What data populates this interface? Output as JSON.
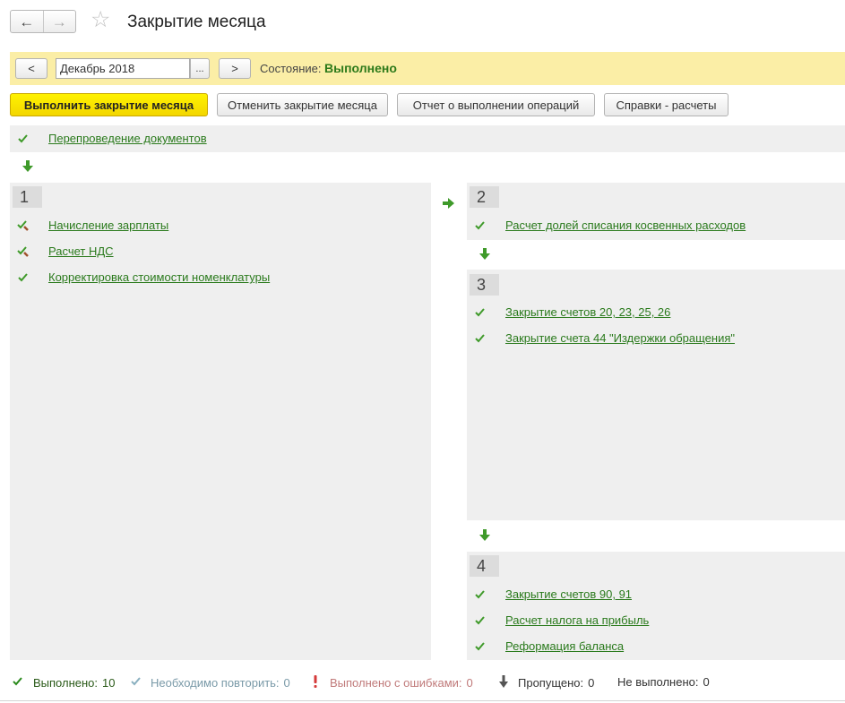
{
  "header": {
    "back_icon": "←",
    "forward_icon": "→",
    "star_icon": "☆",
    "title": "Закрытие месяца"
  },
  "period_bar": {
    "prev_label": "<",
    "period_value": "Декабрь 2018",
    "select_label": "...",
    "next_label": ">",
    "state_label": "Состояние:",
    "state_value": "Выполнено"
  },
  "toolbar": {
    "execute_label": "Выполнить закрытие месяца",
    "cancel_label": "Отменить закрытие месяца",
    "report_label": "Отчет о выполнении операций",
    "calc_label": "Справки - расчеты"
  },
  "pre_step": {
    "label": "Перепроведение документов"
  },
  "groups": [
    {
      "number": "1",
      "items": [
        "Начисление зарплаты",
        "Расчет НДС",
        "Корректировка стоимости номенклатуры"
      ]
    },
    {
      "number": "2",
      "items": [
        "Расчет долей списания косвенных расходов"
      ]
    },
    {
      "number": "3",
      "items": [
        "Закрытие счетов 20, 23, 25, 26",
        "Закрытие счета 44 \"Издержки обращения\""
      ]
    },
    {
      "number": "4",
      "items": [
        "Закрытие счетов 90, 91",
        "Расчет налога на прибыль",
        "Реформация баланса"
      ]
    }
  ],
  "status_bar": {
    "done_label": "Выполнено:",
    "done_count": "10",
    "repeat_label": "Необходимо повторить:",
    "repeat_count": "0",
    "errors_label": "Выполнено с ошибками:",
    "errors_count": "0",
    "skipped_label": "Пропущено:",
    "skipped_count": "0",
    "not_done_label": "Не выполнено:",
    "not_done_count": "0"
  },
  "colors": {
    "accent_green": "#2a7a1c",
    "state_green": "#2d7a1a",
    "yellow_bar": "#fbeea6",
    "primary_button": "#f3d600"
  }
}
